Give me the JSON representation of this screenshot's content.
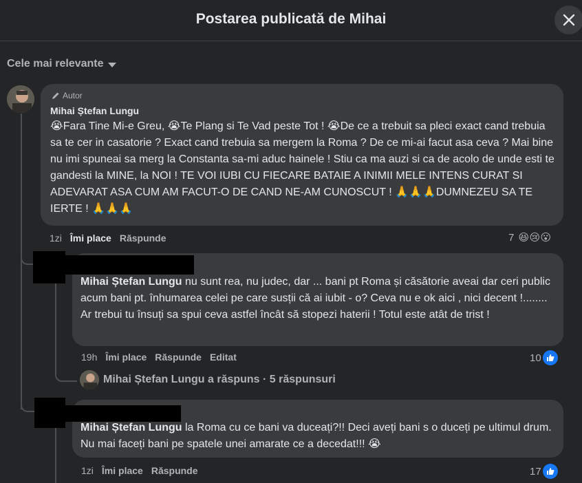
{
  "header": {
    "title": "Postarea publicată de Mihai"
  },
  "sort": {
    "label": "Cele mai relevante"
  },
  "comments": [
    {
      "badge": "Autor",
      "author": "Mihai Ștefan Lungu",
      "text": "😭Fara Tine Mi-e Greu, 😭Te Plang si Te Vad peste Tot ! 😭De ce a trebuit sa pleci exact cand trebuia sa te cer in casatorie ? Exact cand trebuia sa mergem la Roma ? De ce mi-ai facut asa ceva ? Mai bine nu imi spuneai sa merg la Constanta sa-mi aduc hainele ! Stiu ca ma auzi si ca de acolo de unde esti te gandesti la MINE, la NOI ! TE VOI IUBI CU FIECARE BATAIE A INIMII MELE INTENS CURAT SI ADEVARAT ASA CUM AM FACUT-O DE CAND NE-AM CUNOSCUT ! 🙏🙏🙏DUMNEZEU SA TE IERTE ! 🙏🙏🙏",
      "time": "1zi",
      "like": "Îmi place",
      "reply": "Răspunde",
      "reaction_count": "7",
      "reactions": [
        "😆",
        "😢",
        "😮"
      ]
    },
    {
      "mention": "Mihai Ștefan Lungu",
      "text": " nu sunt rea, nu judec, dar ... bani pt Roma și căsătorie aveai dar ceri public acum bani pt. înhumarea celei pe care susții că ai iubit - o? Ceva nu e ok aici , nici decent !........ Ar trebui tu însuți sa spui ceva astfel încât să stopezi haterii ! Totul este atât de trist !",
      "time": "19h",
      "like": "Îmi place",
      "reply": "Răspunde",
      "edited": "Editat",
      "reaction_count": "10"
    },
    {
      "replies_link": "Mihai Ștefan Lungu a răspuns · 5 răspunsuri"
    },
    {
      "mention": "Mihai Ștefan Lungu",
      "text": " la Roma cu ce bani va duceați?!! Deci aveți bani s o duceți pe ultimul drum. Nu mai faceți bani pe spatele unei amarate ce a decedat!!! 😭",
      "time": "1zi",
      "like": "Îmi place",
      "reply": "Răspunde",
      "reaction_count": "17"
    }
  ],
  "colors": {
    "background": "#242526",
    "bubble": "#3a3b3c",
    "like_blue": "#1877f2",
    "secondary_text": "#b0b3b8"
  }
}
